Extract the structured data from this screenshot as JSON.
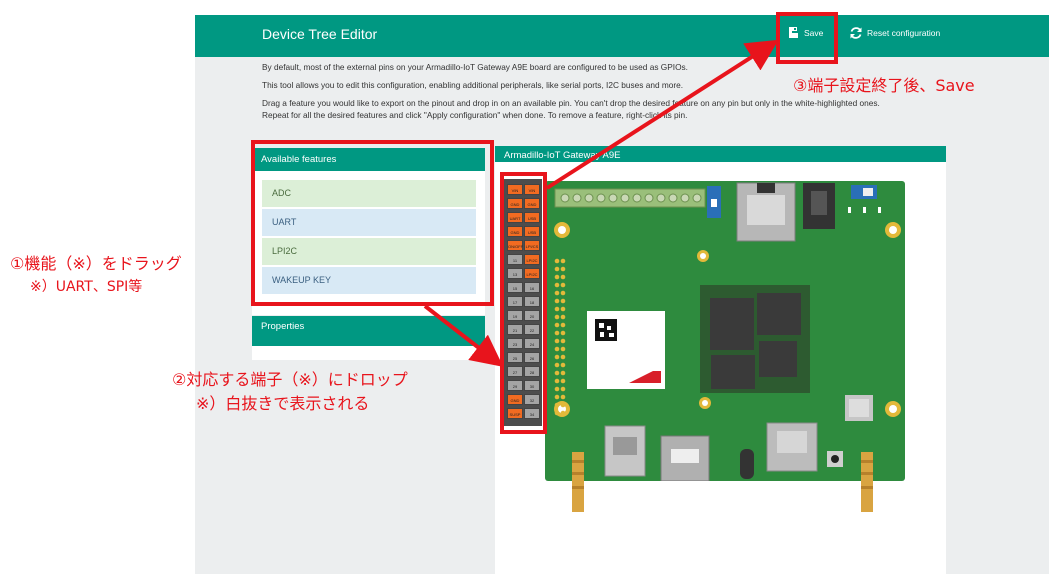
{
  "header": {
    "title": "Device Tree Editor",
    "save_label": "Save",
    "reset_label": "Reset configuration"
  },
  "intro": {
    "line1": "By default, most of the external pins on your Armadillo-IoT Gateway A9E board are configured to be used as GPIOs.",
    "line2": "This tool allows you to edit this configuration, enabling additional peripherals, like serial ports, I2C buses and more.",
    "line3": "Drag a feature you would like to export on the pinout and drop in on an available pin. You can't drop the desired feature on any pin but only in the white-highlighted ones.",
    "line4": "Repeat for all the desired features and click \"Apply configuration\" when done. To remove a feature, right-click its pin."
  },
  "features_panel": {
    "title": "Available features",
    "items": [
      {
        "label": "ADC",
        "color": "#dcefd7"
      },
      {
        "label": "UART",
        "color": "#d8e9f5"
      },
      {
        "label": "LPI2C",
        "color": "#dcefd7"
      },
      {
        "label": "WAKEUP KEY",
        "color": "#d8e9f5"
      }
    ]
  },
  "properties_panel": {
    "title": "Properties"
  },
  "board_panel": {
    "title": "Armadillo-IoT Gateway A9E"
  },
  "pins": {
    "rows": [
      [
        "VIN",
        "VIN"
      ],
      [
        "GND",
        "GND"
      ],
      [
        "UART",
        "USB"
      ],
      [
        "GND",
        "USB"
      ],
      [
        "ON/OFF",
        "LPI/CS"
      ],
      [
        "11",
        "LPI2C"
      ],
      [
        "13",
        "LPI2C"
      ],
      [
        "15",
        "16"
      ],
      [
        "17",
        "18"
      ],
      [
        "19",
        "20"
      ],
      [
        "21",
        "22"
      ],
      [
        "23",
        "24"
      ],
      [
        "25",
        "26"
      ],
      [
        "27",
        "28"
      ],
      [
        "29",
        "30"
      ],
      [
        "GND",
        "32"
      ],
      [
        "SUSP",
        "34"
      ]
    ],
    "types": [
      [
        "or",
        "or"
      ],
      [
        "or",
        "or"
      ],
      [
        "or",
        "or"
      ],
      [
        "or",
        "or"
      ],
      [
        "or",
        "or"
      ],
      [
        "gr",
        "or"
      ],
      [
        "gr",
        "or"
      ],
      [
        "gr",
        "gr"
      ],
      [
        "gr",
        "gr"
      ],
      [
        "gr",
        "gr"
      ],
      [
        "gr",
        "gr"
      ],
      [
        "gr",
        "gr"
      ],
      [
        "gr",
        "gr"
      ],
      [
        "gr",
        "gr"
      ],
      [
        "gr",
        "gr"
      ],
      [
        "or",
        "gr"
      ],
      [
        "or",
        "gr"
      ]
    ]
  },
  "annotations": {
    "step1_line1": "①機能（※）をドラッグ",
    "step1_line2": "※）UART、SPI等",
    "step2_line1": "②対応する端子（※）にドロップ",
    "step2_line2": "※）白抜きで表示される",
    "step3": "③端子設定終了後、Save",
    "color": "#e8141c"
  },
  "colors": {
    "header": "#009882",
    "background": "#eceeef",
    "pcb": "#2e8b3e",
    "pin_orange": "#f26b21",
    "pin_gray": "#a4a4a4"
  }
}
